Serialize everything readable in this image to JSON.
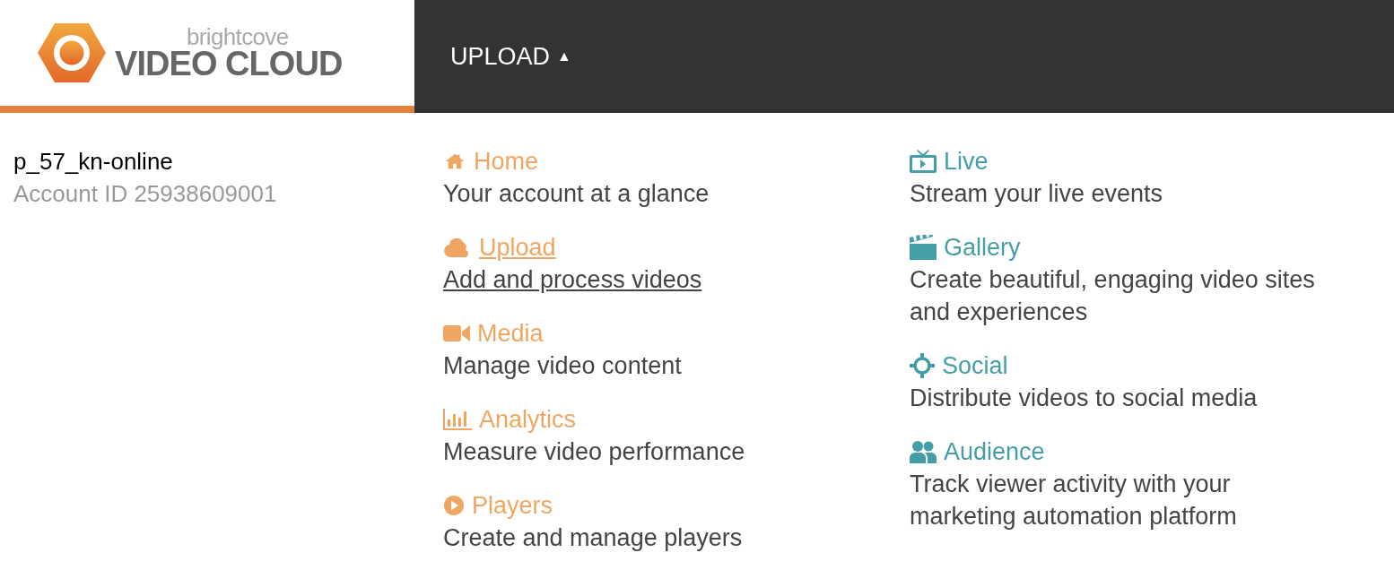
{
  "logo": {
    "small_text": "brightcove",
    "large_text": "VIDEO CLOUD"
  },
  "nav": {
    "label": "UPLOAD",
    "caret": "▲"
  },
  "account": {
    "name": "p_57_kn-online",
    "id_label": "Account ID 25938609001"
  },
  "columns": [
    {
      "color": "#f0a660",
      "items": [
        {
          "kind": "home",
          "title": "Home",
          "description": "Your account at a glance",
          "hovered": false
        },
        {
          "kind": "cloud",
          "title": "Upload",
          "description": "Add and process videos",
          "hovered": true
        },
        {
          "kind": "camera",
          "title": "Media",
          "description": "Manage video content",
          "hovered": false
        },
        {
          "kind": "chart",
          "title": "Analytics",
          "description": "Measure video performance",
          "hovered": false
        },
        {
          "kind": "play",
          "title": "Players",
          "description": "Create and manage players",
          "hovered": false
        }
      ]
    },
    {
      "color": "#449ea8",
      "items": [
        {
          "kind": "tv",
          "title": "Live",
          "description": "Stream your live events",
          "hovered": false
        },
        {
          "kind": "clapper",
          "title": "Gallery",
          "description": "Create beautiful, engaging video sites and experiences",
          "hovered": false
        },
        {
          "kind": "crosshair",
          "title": "Social",
          "description": "Distribute videos to social media",
          "hovered": false
        },
        {
          "kind": "users",
          "title": "Audience",
          "description": "Track viewer activity with your marketing automation platform",
          "hovered": false
        }
      ]
    }
  ]
}
